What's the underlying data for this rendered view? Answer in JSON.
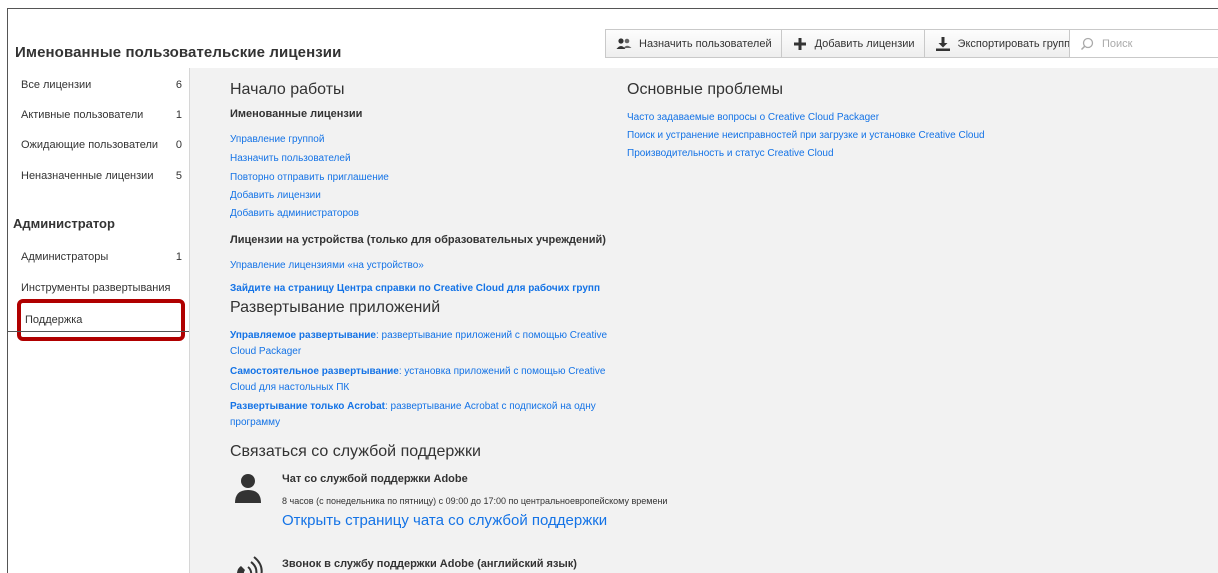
{
  "header": {
    "title": "Именованные пользовательские лицензии",
    "buttons": {
      "assign": "Назначить пользователей",
      "add": "Добавить лицензии",
      "export": "Экспортировать группу"
    },
    "search_placeholder": "Поиск"
  },
  "sidebar": {
    "licenses": [
      {
        "label": "Все лицензии",
        "count": "6"
      },
      {
        "label": "Активные пользователи",
        "count": "1"
      },
      {
        "label": "Ожидающие пользователи",
        "count": "0"
      },
      {
        "label": "Неназначенные лицензии",
        "count": "5"
      }
    ],
    "admin_heading": "Администратор",
    "admin_items": [
      {
        "label": "Администраторы",
        "count": "1"
      },
      {
        "label": "Инструменты развертывания",
        "count": ""
      },
      {
        "label": "Поддержка",
        "count": ""
      }
    ]
  },
  "main": {
    "getting_started": {
      "title": "Начало работы",
      "named_heading": "Именованные лицензии",
      "named_links": [
        "Управление группой",
        "Назначить пользователей",
        "Повторно отправить приглашение",
        "Добавить лицензии",
        "Добавить администраторов"
      ],
      "device_heading": "Лицензии на устройства (только для образовательных учреждений)",
      "device_link": "Управление лицензиями «на устройство»",
      "help_link": "Зайдите на страницу Центра справки по Creative Cloud для рабочих групп"
    },
    "deployment": {
      "title": "Развертывание приложений",
      "items": [
        {
          "bold": "Управляемое развертывание",
          "text": ": развертывание приложений с помощью Creative Cloud Packager"
        },
        {
          "bold": "Самостоятельное развертывание",
          "text": ": установка приложений с помощью Creative Cloud для настольных ПК"
        },
        {
          "bold": "Развертывание только Acrobat",
          "text": ": развертывание Acrobat с подпиской на одну программу"
        }
      ]
    },
    "support": {
      "title": "Связаться со службой поддержки",
      "chat_title": "Чат со службой поддержки Adobe",
      "chat_hours": "8 часов (с понедельника по пятницу) с 09:00 до 17:00 по центральноевропейскому времени",
      "chat_link": "Открыть страницу чата со службой поддержки",
      "phone_title": "Звонок в службу поддержки Adobe (английский язык)"
    },
    "issues": {
      "title": "Основные проблемы",
      "links": [
        "Часто задаваемые вопросы о Creative Cloud Packager",
        "Поиск и устранение неисправностей при загрузке и установке Creative Cloud",
        "Производительность и статус Creative Cloud"
      ]
    }
  },
  "colors": {
    "link": "#1473e6",
    "highlight": "#b00000",
    "panel": "#f2f2f2"
  }
}
